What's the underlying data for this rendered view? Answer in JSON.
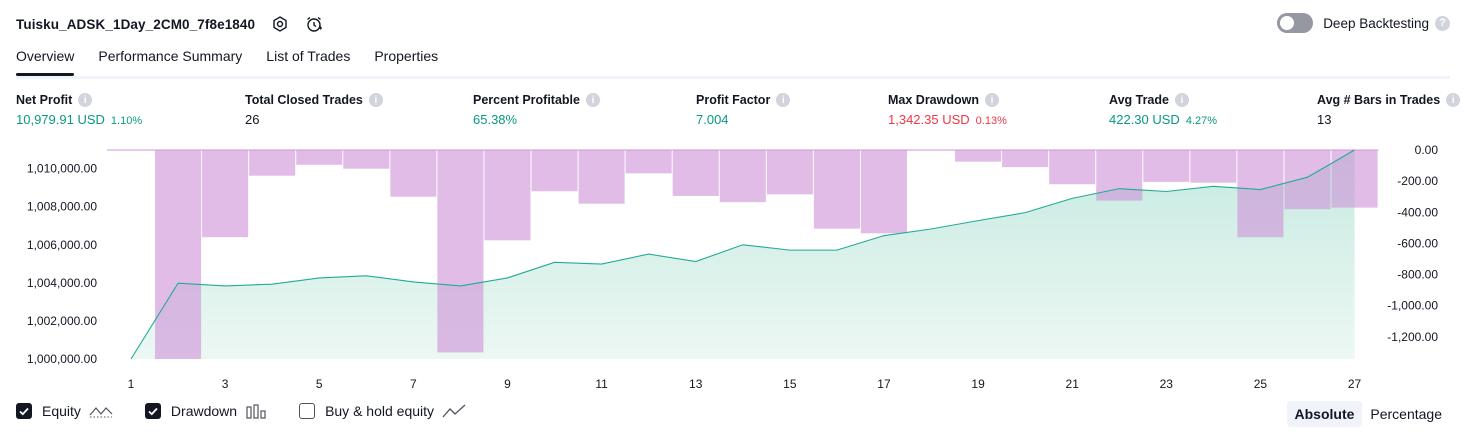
{
  "header": {
    "strategy_title": "Tuisku_ADSK_1Day_2CM0_7f8e1840",
    "deep_backtesting_label": "Deep Backtesting",
    "help_glyph": "?"
  },
  "tabs": [
    {
      "label": "Overview",
      "active": true
    },
    {
      "label": "Performance Summary",
      "active": false
    },
    {
      "label": "List of Trades",
      "active": false
    },
    {
      "label": "Properties",
      "active": false
    }
  ],
  "metrics": [
    {
      "label": "Net Profit",
      "value": "10,979.91 USD",
      "pct": "1.10%",
      "color": "#089981"
    },
    {
      "label": "Total Closed Trades",
      "value": "26",
      "pct": "",
      "color": "#131722"
    },
    {
      "label": "Percent Profitable",
      "value": "65.38%",
      "pct": "",
      "color": "#089981"
    },
    {
      "label": "Profit Factor",
      "value": "7.004",
      "pct": "",
      "color": "#089981"
    },
    {
      "label": "Max Drawdown",
      "value": "1,342.35 USD",
      "pct": "0.13%",
      "color": "#f23645"
    },
    {
      "label": "Avg Trade",
      "value": "422.30 USD",
      "pct": "4.27%",
      "color": "#089981"
    },
    {
      "label": "Avg # Bars in Trades",
      "value": "13",
      "pct": "",
      "color": "#131722"
    }
  ],
  "chart_data": {
    "type": "area",
    "x": [
      1,
      2,
      3,
      4,
      5,
      6,
      7,
      8,
      9,
      10,
      11,
      12,
      13,
      14,
      15,
      16,
      17,
      18,
      19,
      20,
      21,
      22,
      23,
      24,
      25,
      26,
      27
    ],
    "x_tick_labels": [
      "1",
      "3",
      "5",
      "7",
      "9",
      "11",
      "13",
      "15",
      "17",
      "19",
      "21",
      "23",
      "25",
      "27"
    ],
    "y_left_tick_labels": [
      "1,010,000.00",
      "1,008,000.00",
      "1,006,000.00",
      "1,004,000.00",
      "1,002,000.00",
      "1,000,000.00"
    ],
    "y_right_tick_labels": [
      "0.00",
      "-200.00",
      "-400.00",
      "-600.00",
      "-800.00",
      "-1,000.00",
      "-1,200.00"
    ],
    "ylim_left": [
      1000000,
      1010979.91
    ],
    "ylim_right": [
      -1342.35,
      0
    ],
    "series": [
      {
        "name": "Equity",
        "kind": "line",
        "axis": "left",
        "color": "#22ab94",
        "values": [
          1000000,
          1003980,
          1003840,
          1003930,
          1004260,
          1004370,
          1004050,
          1003840,
          1004260,
          1005080,
          1004990,
          1005510,
          1005120,
          1006000,
          1005720,
          1005720,
          1006480,
          1006830,
          1007270,
          1007690,
          1008440,
          1008950,
          1008800,
          1009070,
          1008900,
          1009550,
          1010979.91
        ]
      },
      {
        "name": "Drawdown",
        "kind": "bar",
        "axis": "right",
        "color": "#ce93d8",
        "values": [
          0,
          -1342.35,
          -560,
          -165,
          -95,
          -120,
          -300,
          -1300,
          -580,
          -265,
          -345,
          -150,
          -295,
          -335,
          -285,
          -505,
          -535,
          0,
          -75,
          -110,
          -220,
          -325,
          -205,
          -210,
          -560,
          -380,
          -370
        ]
      }
    ]
  },
  "legend": {
    "equity_label": "Equity",
    "drawdown_label": "Drawdown",
    "buy_hold_label": "Buy & hold equity"
  },
  "mode": {
    "absolute_label": "Absolute",
    "percentage_label": "Percentage"
  }
}
